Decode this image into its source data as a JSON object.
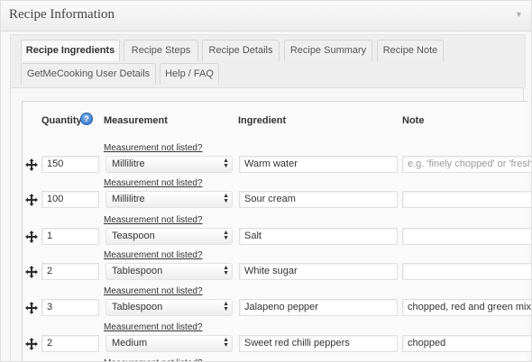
{
  "header": {
    "title": "Recipe Information",
    "toggle_icon": "triangle-down-icon"
  },
  "tabs": [
    {
      "label": "Recipe Ingredients",
      "active": true
    },
    {
      "label": "Recipe Steps",
      "active": false
    },
    {
      "label": "Recipe Details",
      "active": false
    },
    {
      "label": "Recipe Summary",
      "active": false
    },
    {
      "label": "Recipe Note",
      "active": false
    },
    {
      "label": "GetMeCooking User Details",
      "active": false
    },
    {
      "label": "Help / FAQ",
      "active": false
    }
  ],
  "table": {
    "headers": {
      "quantity": "Quantity",
      "measurement": "Measurement",
      "ingredient": "Ingredient",
      "note": "Note"
    },
    "help_icon": "?",
    "measurement_link": "Measurement not listed?",
    "note_placeholder": "e.g. 'finely chopped' or 'freshly",
    "rows": [
      {
        "quantity": "150",
        "measurement": "Millilitre",
        "ingredient": "Warm water",
        "note": ""
      },
      {
        "quantity": "100",
        "measurement": "Millilitre",
        "ingredient": "Sour cream",
        "note": ""
      },
      {
        "quantity": "1",
        "measurement": "Teaspoon",
        "ingredient": "Salt",
        "note": ""
      },
      {
        "quantity": "2",
        "measurement": "Tablespoon",
        "ingredient": "White sugar",
        "note": ""
      },
      {
        "quantity": "3",
        "measurement": "Tablespoon",
        "ingredient": "Jalapeno pepper",
        "note": "chopped, red and green mix"
      },
      {
        "quantity": "2",
        "measurement": "Medium",
        "ingredient": "Sweet red chilli peppers",
        "note": "chopped"
      }
    ]
  },
  "icons": {
    "drag": "move-arrows-icon",
    "select_arrow": "up-down-arrows-icon"
  }
}
